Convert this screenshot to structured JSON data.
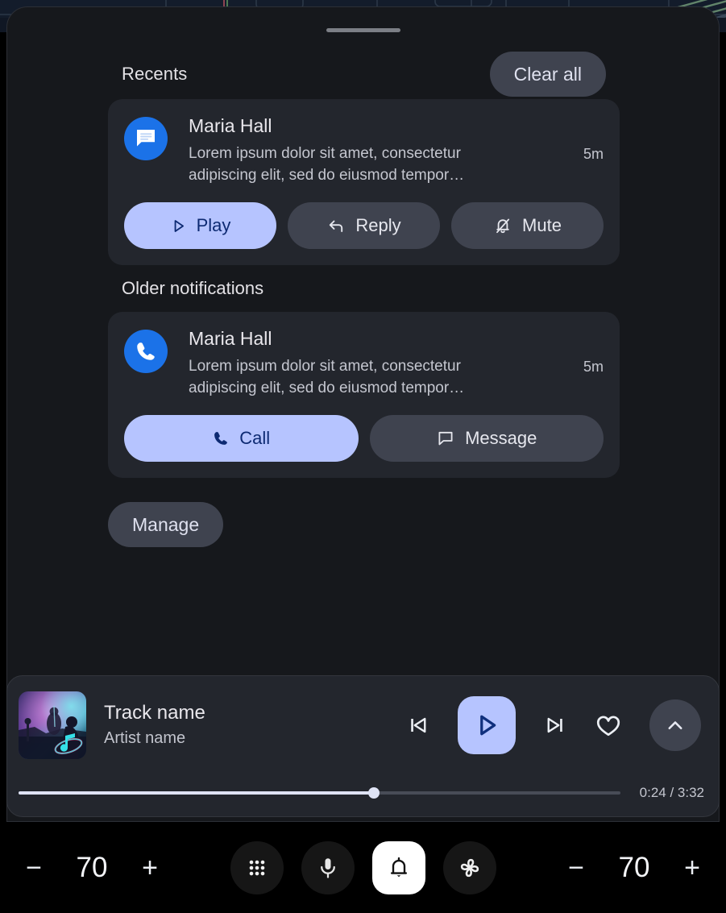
{
  "panel": {
    "drag_handle_name": "drag-handle"
  },
  "recents": {
    "title": "Recents",
    "clear_all_label": "Clear all",
    "notification": {
      "app_icon": "messages-icon",
      "sender": "Maria Hall",
      "body": "Lorem ipsum dolor sit amet, consectetur\nadipiscing elit, sed do eiusmod tempor…",
      "timestamp": "5m",
      "actions": [
        {
          "label": "Play",
          "icon": "play-icon",
          "style": "primary"
        },
        {
          "label": "Reply",
          "icon": "reply-arrow-icon",
          "style": "secondary"
        },
        {
          "label": "Mute",
          "icon": "bell-slash-icon",
          "style": "secondary"
        }
      ]
    }
  },
  "older": {
    "title": "Older notifications",
    "notification": {
      "app_icon": "phone-icon",
      "sender": "Maria Hall",
      "body": "Lorem ipsum dolor sit amet, consectetur\nadipiscing elit, sed do eiusmod tempor…",
      "timestamp": "5m",
      "actions": [
        {
          "label": "Call",
          "icon": "phone-icon",
          "style": "primary"
        },
        {
          "label": "Message",
          "icon": "chat-bubble-icon",
          "style": "secondary"
        }
      ]
    }
  },
  "manage_label": "Manage",
  "media": {
    "album_art": "concert-album-art",
    "track_name": "Track name",
    "artist_name": "Artist name",
    "controls": [
      {
        "name": "skip-previous-icon"
      },
      {
        "name": "play-icon"
      },
      {
        "name": "skip-next-icon"
      },
      {
        "name": "heart-icon"
      },
      {
        "name": "chevron-up-icon"
      }
    ],
    "elapsed": "0:24",
    "duration": "3:32",
    "time_label": "0:24 / 3:32",
    "progress_percent": 59
  },
  "navbar": {
    "left_volume": {
      "minus": "−",
      "value": "70",
      "plus": "+"
    },
    "right_volume": {
      "minus": "−",
      "value": "70",
      "plus": "+"
    },
    "center_items": [
      {
        "name": "apps-grid-icon",
        "active": false
      },
      {
        "name": "microphone-icon",
        "active": false
      },
      {
        "name": "bell-icon",
        "active": true
      },
      {
        "name": "fan-icon",
        "active": false
      }
    ]
  },
  "colors": {
    "accent_primary": "#b6c4ff",
    "accent_on_primary": "#0d2a72",
    "surface_card": "#23262d",
    "surface_button": "#3f434f",
    "panel_bg": "#16181c",
    "app_icon_blue": "#1b72e8",
    "navbar_bg": "#000000"
  }
}
